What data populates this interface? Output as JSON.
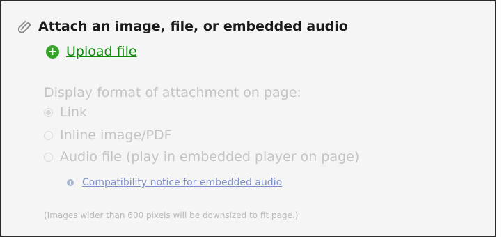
{
  "section": {
    "title": "Attach an image, file, or embedded audio",
    "icon": "paperclip-icon"
  },
  "upload": {
    "label": "Upload file",
    "icon": "plus-circle-icon",
    "accent_color": "#37a32b"
  },
  "display_format": {
    "label": "Display format of attachment on page:",
    "options": [
      {
        "label": "Link",
        "selected": true
      },
      {
        "label": "Inline image/PDF",
        "selected": false
      },
      {
        "label": "Audio file (play in embedded player on page)",
        "selected": false
      }
    ],
    "notice_link": "Compatibility notice for embedded audio"
  },
  "footnote": "(Images wider than 600 pixels will be downsized to fit page.)"
}
